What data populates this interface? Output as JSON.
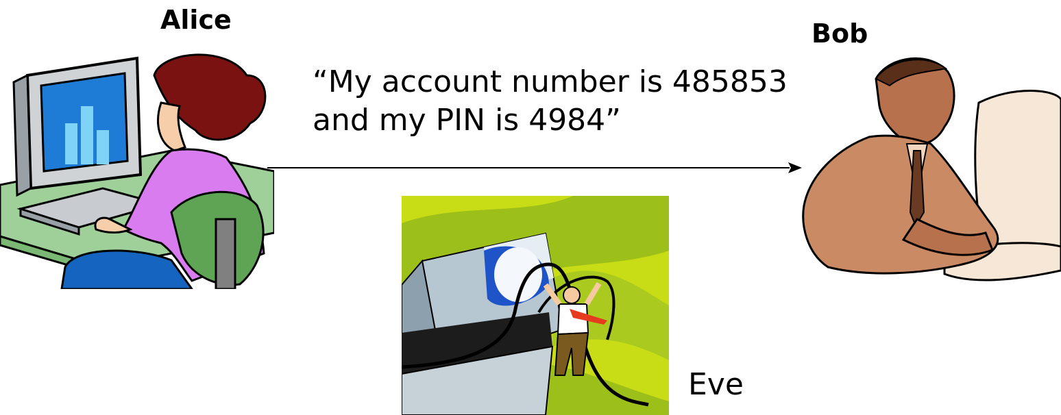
{
  "alice": {
    "name": "Alice"
  },
  "bob": {
    "name": "Bob"
  },
  "message": {
    "line1": "“My account number is 485853",
    "line2": "and my PIN is 4984”"
  },
  "eve": {
    "name": "Eve"
  }
}
